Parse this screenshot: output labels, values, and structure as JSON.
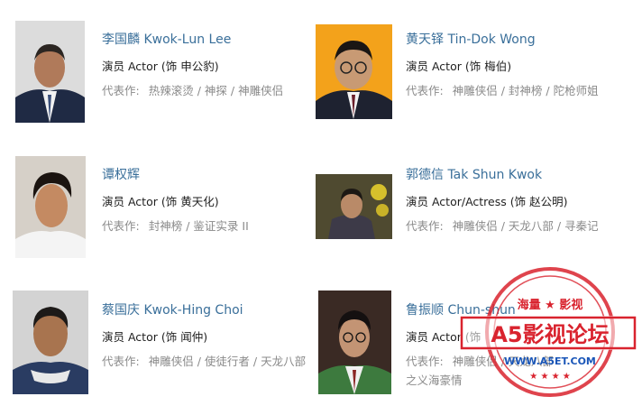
{
  "works_label": "代表作:",
  "separator": "/",
  "cast": [
    {
      "name": "李国麟 Kwok-Lun Lee",
      "role": "演员 Actor (饰 申公豹)",
      "works": [
        "热辣滚烫",
        "神探",
        "神雕侠侣"
      ]
    },
    {
      "name": "黄天铎 Tin-Dok Wong",
      "role": "演员 Actor (饰 梅伯)",
      "works": [
        "神雕侠侣",
        "封神榜",
        "陀枪师姐"
      ]
    },
    {
      "name": "谭权辉",
      "role": "演员 Actor (饰 黄天化)",
      "works": [
        "封神榜",
        "鉴证实录 II"
      ]
    },
    {
      "name": "郭德信 Tak Shun Kwok",
      "role": "演员 Actor/Actress (饰 赵公明)",
      "works": [
        "神雕侠侣",
        "天龙八部",
        "寻秦记"
      ]
    },
    {
      "name": "蔡国庆 Kwok-Hing Choi",
      "role": "演员 Actor (饰 闻仲)",
      "works": [
        "神雕侠侣",
        "使徒行者",
        "天龙八部"
      ]
    },
    {
      "name": "鲁振顺 Chun-shun",
      "role": "演员 Actor (饰",
      "works": [
        "神雕侠侣",
        "天龙八部",
        "之义海豪情"
      ]
    }
  ],
  "watermark": {
    "top": "海量 ★ 影视",
    "main": "A5影视论坛",
    "url": "WWW.A5ET.COM",
    "color": "#d9232e"
  }
}
